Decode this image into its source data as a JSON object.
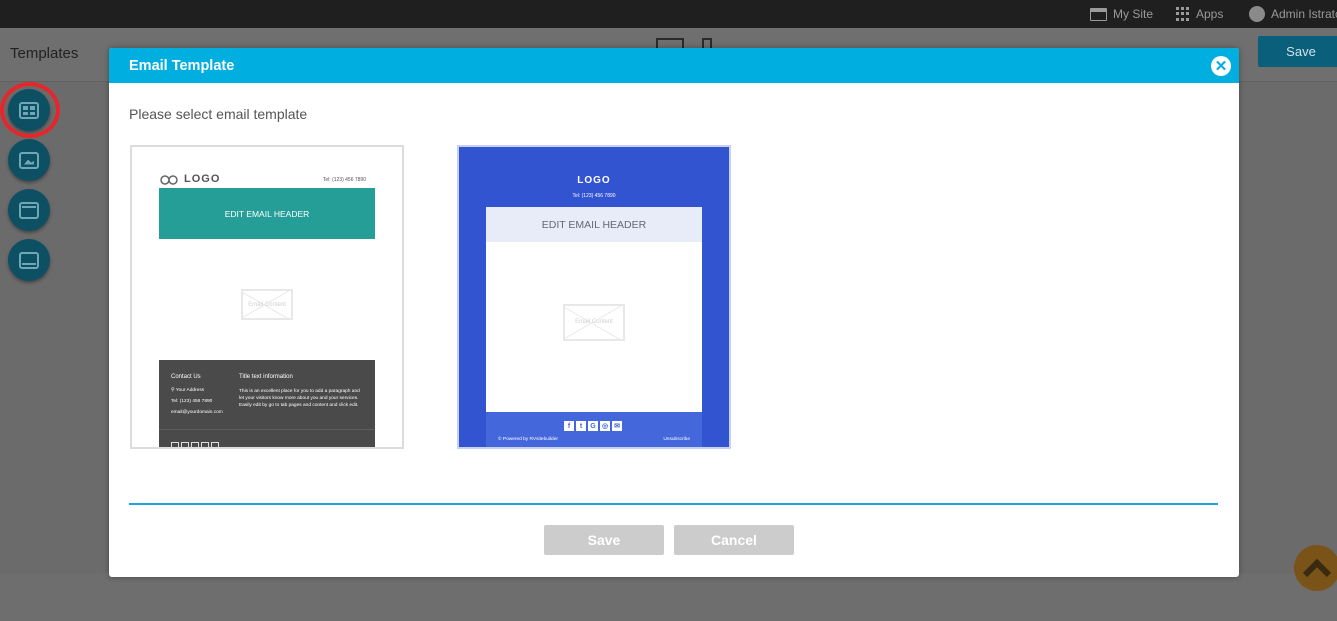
{
  "topbar": {
    "my_site": "My Site",
    "apps": "Apps",
    "user": "Admin Istrator"
  },
  "toolbar": {
    "title": "Templates",
    "save_label": "Save"
  },
  "modal": {
    "title": "Email Template",
    "prompt": "Please select email template",
    "save_label": "Save",
    "cancel_label": "Cancel",
    "templates": [
      {
        "logo": "LOGO",
        "tel": "Tel: (123) 456 7890",
        "header": "EDIT EMAIL HEADER",
        "content_placeholder": "Email Content",
        "footer": {
          "contact_heading": "Contact Us",
          "address": "Your Address",
          "tel": "Tel: (123) 456 7890",
          "email": "email@yourdomain.com",
          "title_heading": "Title text information",
          "paragraph": "This is an excellent place for you to add a paragraph and let your visitors know more about you and your services. Easily edit by go to tab pages and content and click edit."
        }
      },
      {
        "logo": "LOGO",
        "tel": "Tel: (123) 456 7890",
        "header": "EDIT EMAIL HEADER",
        "content_placeholder": "Email Content",
        "footer": {
          "powered": "© Powered by RVsitebuilder",
          "unsubscribe": "Unsubscribe"
        }
      }
    ]
  },
  "colors": {
    "modal_header": "#00aee0",
    "template1_header": "#269e98",
    "template2_background": "#3354d0",
    "highlight_ring": "#e5272d"
  }
}
